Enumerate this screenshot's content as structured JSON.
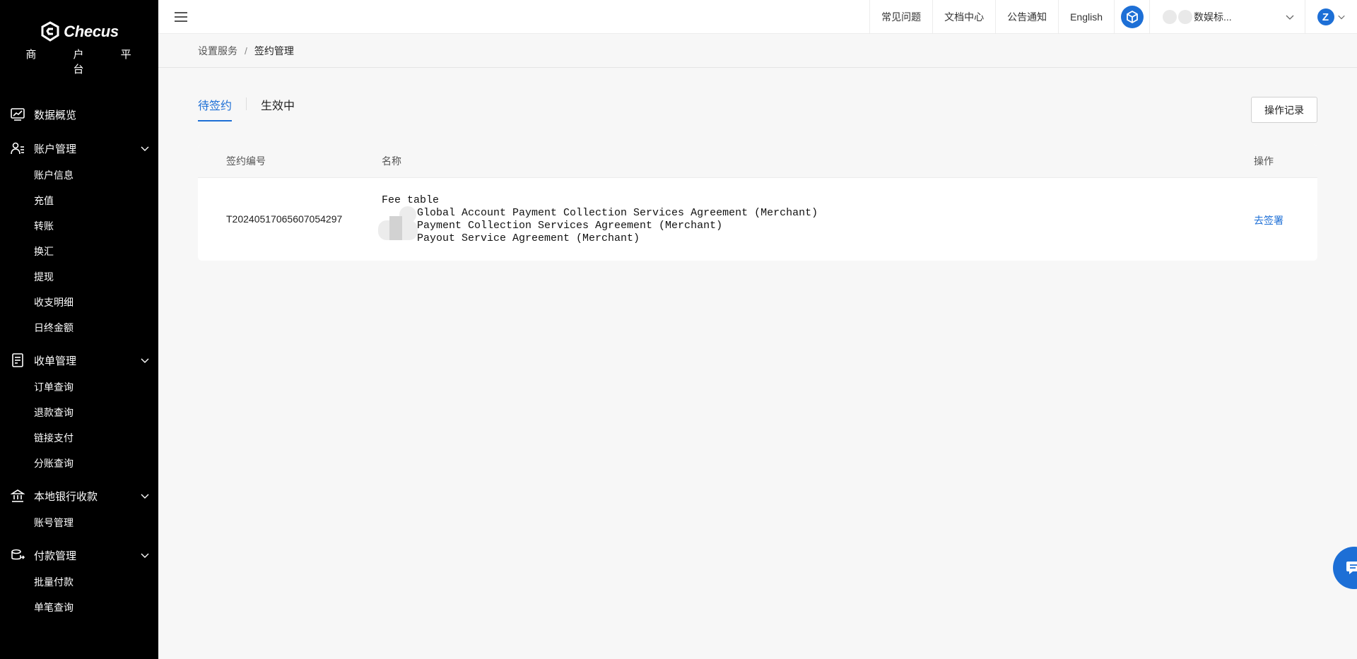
{
  "brand": {
    "name": "Checus",
    "subtitle": "商 户 平 台"
  },
  "sidebar": {
    "groups": [
      {
        "label": "数据概览",
        "icon": "chart-icon",
        "items": []
      },
      {
        "label": "账户管理",
        "icon": "user-icon",
        "items": [
          "账户信息",
          "充值",
          "转账",
          "换汇",
          "提现",
          "收支明细",
          "日终金额"
        ]
      },
      {
        "label": "收单管理",
        "icon": "receipt-icon",
        "items": [
          "订单查询",
          "退款查询",
          "链接支付",
          "分账查询"
        ]
      },
      {
        "label": "本地银行收款",
        "icon": "bank-icon",
        "items": [
          "账号管理"
        ]
      },
      {
        "label": "付款管理",
        "icon": "payment-icon",
        "items": [
          "批量付款",
          "单笔查询"
        ]
      }
    ]
  },
  "header": {
    "links": [
      "常见问题",
      "文档中心",
      "公告通知",
      "English"
    ],
    "account_name": "数娱标...",
    "user_initial": "Z"
  },
  "breadcrumb": {
    "parent": "设置服务",
    "separator": "/",
    "current": "签约管理"
  },
  "tabs": [
    {
      "label": "待签约",
      "active": true
    },
    {
      "label": "生效中",
      "active": false
    }
  ],
  "ops_button": "操作记录",
  "table": {
    "columns": [
      "签约编号",
      "名称",
      "操作"
    ],
    "rows": [
      {
        "id": "T20240517065607054297",
        "names": [
          "Fee table",
          "Global Account Payment Collection Services Agreement (Merchant)",
          "Payment Collection Services Agreement (Merchant)",
          "Payout Service Agreement (Merchant)"
        ],
        "action": "去签署"
      }
    ]
  },
  "colors": {
    "accent": "#1d6fd6",
    "sidebar_bg": "#000000"
  }
}
